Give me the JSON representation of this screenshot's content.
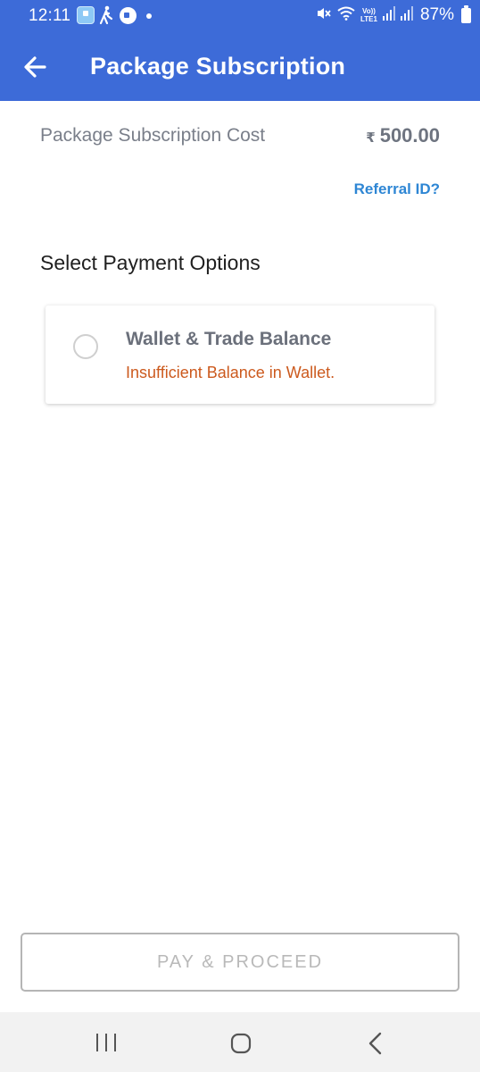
{
  "status_bar": {
    "time": "12:11",
    "battery": "87%",
    "volte_top": "Vo))",
    "volte_bottom": "LTE1",
    "bg_color": "#3d6bd8"
  },
  "app_bar": {
    "title": "Package Subscription",
    "back_icon": "arrow-left-icon",
    "bg_color": "#3d6bd8"
  },
  "cost": {
    "label": "Package Subscription Cost",
    "currency": "₹",
    "amount": "500.00"
  },
  "referral_link": "Referral ID?",
  "payment_section": {
    "title": "Select Payment Options",
    "options": [
      {
        "title": "Wallet & Trade Balance",
        "message": "Insufficient Balance in Wallet.",
        "selected": false,
        "message_color": "#cc5a1e"
      }
    ]
  },
  "pay_button": {
    "label": "PAY & PROCEED",
    "enabled": false
  },
  "nav_bar": {
    "icons": [
      "recents-icon",
      "home-icon",
      "back-icon"
    ]
  }
}
